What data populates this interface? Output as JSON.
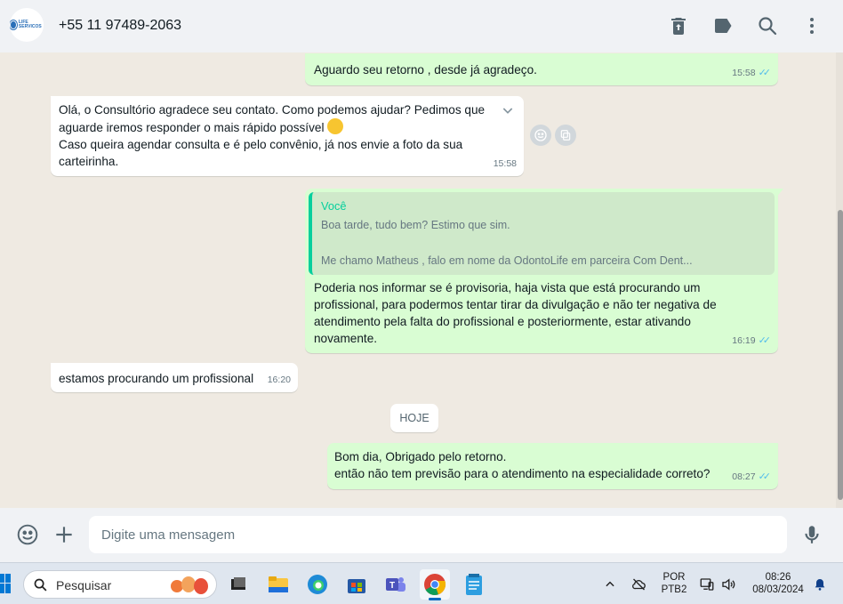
{
  "header": {
    "contact_name": "+55 11 97489-2063",
    "avatar_logo_text": "LIFE SERVICOS",
    "icons": [
      "delete-icon",
      "label-icon",
      "search-icon",
      "menu-dots-icon"
    ]
  },
  "messages": [
    {
      "direction": "out",
      "lines": [
        "Aguardo seu retorno , desde já agradeço."
      ],
      "time": "15:58",
      "status": "read"
    },
    {
      "direction": "in",
      "lines": [
        "Olá, o Consultório agradece seu contato. Como podemos ajudar? Pedimos que",
        "aguarde iremos responder o mais rápido possível",
        "Caso queira agendar consulta e é pelo convênio, já nos envie a foto da sua",
        "carteirinha."
      ],
      "time": "15:58"
    },
    {
      "direction": "out",
      "quote": {
        "author": "Você",
        "lines": [
          "Boa tarde, tudo bem? Estimo que sim.",
          "Me chamo Matheus , falo em nome da OdontoLife em parceira Com Dent..."
        ]
      },
      "lines": [
        "Poderia nos informar se é provisoria, haja vista que está procurando um",
        "profissional, para podermos tentar tirar da divulgação e não ter negativa de",
        "atendimento pela falta do profissional e posteriormente, estar ativando",
        "novamente."
      ],
      "time": "16:19",
      "status": "read"
    },
    {
      "direction": "in",
      "lines": [
        "estamos procurando um profissional"
      ],
      "time": "16:20"
    },
    {
      "direction": "out",
      "lines": [
        "Bom dia, Obrigado pelo retorno.",
        "então não tem previsão para o atendimento na especialidade correto?"
      ],
      "time": "08:27",
      "status": "read"
    }
  ],
  "day_separator": "HOJE",
  "composer": {
    "placeholder": "Digite uma mensagem"
  },
  "taskbar": {
    "search_label": "Pesquisar",
    "language_top": "POR",
    "language_bottom": "PTB2",
    "clock_time": "08:26",
    "clock_date": "08/03/2024"
  },
  "colors": {
    "outgoing_bubble": "#d9fdd3",
    "incoming_bubble": "#ffffff",
    "read_ticks": "#53bdeb",
    "quote_accent": "#06cf9c",
    "chat_bg": "#efeae2"
  }
}
